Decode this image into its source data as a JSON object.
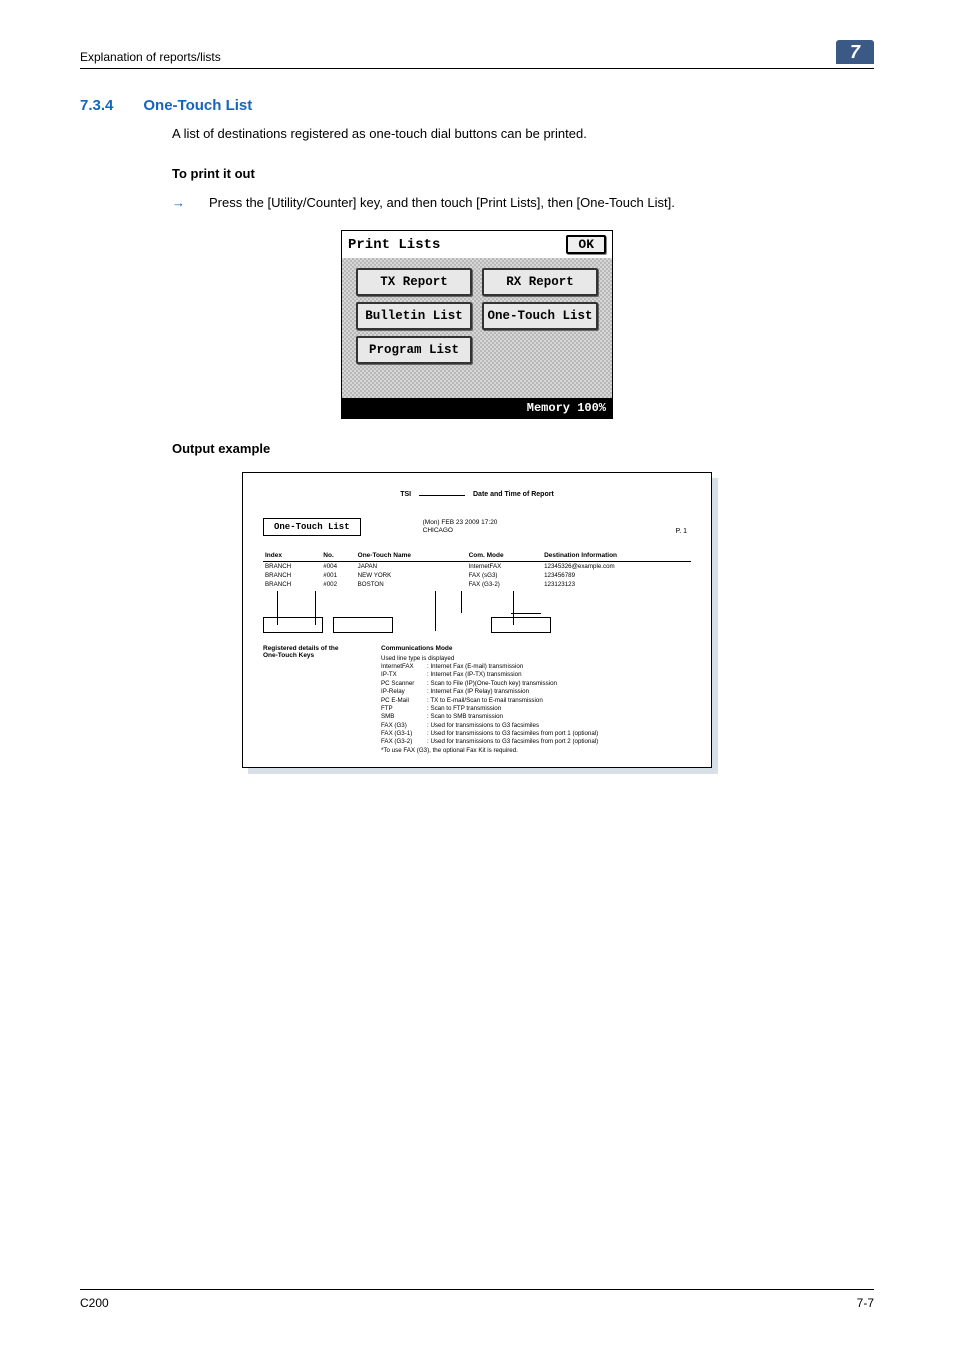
{
  "header": {
    "title": "Explanation of reports/lists",
    "chapter": "7"
  },
  "section": {
    "number": "7.3.4",
    "title": "One-Touch List",
    "intro": "A list of destinations registered as one-touch dial buttons can be printed.",
    "to_print_head": "To print it out",
    "instruction": "Press the [Utility/Counter] key, and then touch [Print Lists], then [One-Touch List]."
  },
  "lcd": {
    "title": "Print Lists",
    "ok": "OK",
    "buttons": {
      "tx": "TX Report",
      "rx": "RX Report",
      "bulletin": "Bulletin List",
      "onetouch": "One-Touch List",
      "program": "Program List"
    },
    "memory": "Memory 100%"
  },
  "output_head": "Output example",
  "report": {
    "tsi_left": "TSI",
    "tsi_right": "Date and Time of Report",
    "title": "One-Touch List",
    "date": "(Mon) FEB 23 2009 17:20",
    "own": "CHICAGO",
    "page": "P.  1",
    "cols": {
      "index": "Index",
      "no": "No.",
      "name": "One-Touch Name",
      "mode": "Com. Mode",
      "dest": "Destination Information"
    },
    "rows": [
      {
        "index": "BRANCH",
        "no": "#004",
        "name": "JAPAN",
        "mode": "InternetFAX",
        "dest": "12345326@example.com"
      },
      {
        "index": "BRANCH",
        "no": "#001",
        "name": "NEW YORK",
        "mode": "FAX (sG3)",
        "dest": "123456789"
      },
      {
        "index": "BRANCH",
        "no": "#002",
        "name": "BOSTON",
        "mode": "FAX (G3-2)",
        "dest": "123123123"
      }
    ],
    "details_left1": "Registered details of the",
    "details_left2": "One-Touch Keys",
    "comm_head": "Communications Mode",
    "comm_sub": "Used line type is displayed",
    "modes": [
      {
        "k": "InternetFAX",
        "v": ": Internet Fax (E-mail) transmission"
      },
      {
        "k": "IP-TX",
        "v": ": Internet Fax (IP-TX) transmission"
      },
      {
        "k": "PC Scanner",
        "v": ": Scan to File (IP)(One-Touch key) transmission"
      },
      {
        "k": "IP-Relay",
        "v": ": Internet Fax (IP Relay) transmission"
      },
      {
        "k": "PC E-Mail",
        "v": ": TX to E-mail/Scan to E-mail transmission"
      },
      {
        "k": "FTP",
        "v": ": Scan to FTP transmission"
      },
      {
        "k": "SMB",
        "v": ": Scan to SMB transmission"
      },
      {
        "k": "FAX (G3)",
        "v": ": Used for transmissions to G3 facsimiles"
      },
      {
        "k": "FAX (G3-1)",
        "v": ": Used for transmissions to G3 facsimiles from port 1 (optional)"
      },
      {
        "k": "FAX (G3-2)",
        "v": ": Used for transmissions to G3 facsimiles from port 2 (optional)"
      }
    ],
    "note": "*To use FAX (G3), the optional Fax Kit is required."
  },
  "footer": {
    "left": "C200",
    "right": "7-7"
  }
}
